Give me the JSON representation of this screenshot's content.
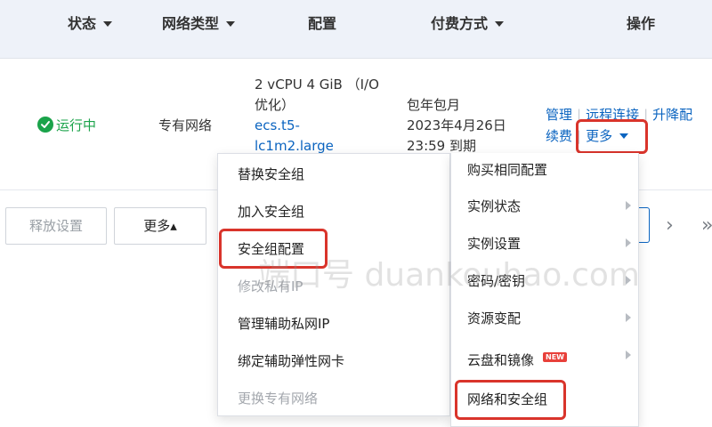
{
  "table": {
    "headers": {
      "status": "状态",
      "network_type": "网络类型",
      "config": "配置",
      "billing": "付费方式",
      "actions": "操作"
    },
    "row": {
      "status": "运行中",
      "network_type": "专有网络",
      "config_line1": "2 vCPU 4 GiB （I/O",
      "config_line2": "优化）",
      "instance_type_line1": "ecs.t5-",
      "instance_type_line2": "lc1m2.large",
      "billing_line1": "包年包月",
      "billing_line2": "2023年4月26日",
      "billing_line3": "23:59 到期",
      "actions": {
        "manage": "管理",
        "remote_connect": "远程连接",
        "upgrade": "升降配",
        "renew": "续费",
        "more": "更多"
      }
    }
  },
  "bottom_bar": {
    "release_settings": "释放设置",
    "more": "更多▴"
  },
  "pager": {
    "next": "›",
    "last": "»"
  },
  "security_group_menu": {
    "items": [
      {
        "label": "替换安全组",
        "disabled": false
      },
      {
        "label": "加入安全组",
        "disabled": false
      },
      {
        "label": "安全组配置",
        "disabled": false,
        "highlighted": true
      },
      {
        "label": "修改私有IP",
        "disabled": true
      },
      {
        "label": "管理辅助私网IP",
        "disabled": false
      },
      {
        "label": "绑定辅助弹性网卡",
        "disabled": false
      },
      {
        "label": "更换专有网络",
        "disabled": true
      }
    ]
  },
  "more_menu": {
    "items": [
      {
        "label": "购买相同配置",
        "submenu": false
      },
      {
        "label": "实例状态",
        "submenu": true
      },
      {
        "label": "实例设置",
        "submenu": true
      },
      {
        "label": "密码/密钥",
        "submenu": true
      },
      {
        "label": "资源变配",
        "submenu": true
      },
      {
        "label": "云盘和镜像",
        "submenu": true,
        "badge": "NEW"
      },
      {
        "label": "网络和安全组",
        "submenu": false,
        "highlighted": true
      }
    ]
  },
  "watermark": "端口号 duankouhao.com",
  "colors": {
    "header_bg": "#eef2f9",
    "link": "#0b64c0",
    "status_green": "#1aa34a",
    "highlight_red": "#d9342b",
    "new_badge": "#e8403a"
  },
  "icons": {
    "status": "check-circle-icon",
    "dropdown": "caret-down-icon",
    "submenu": "chevron-right-icon"
  }
}
